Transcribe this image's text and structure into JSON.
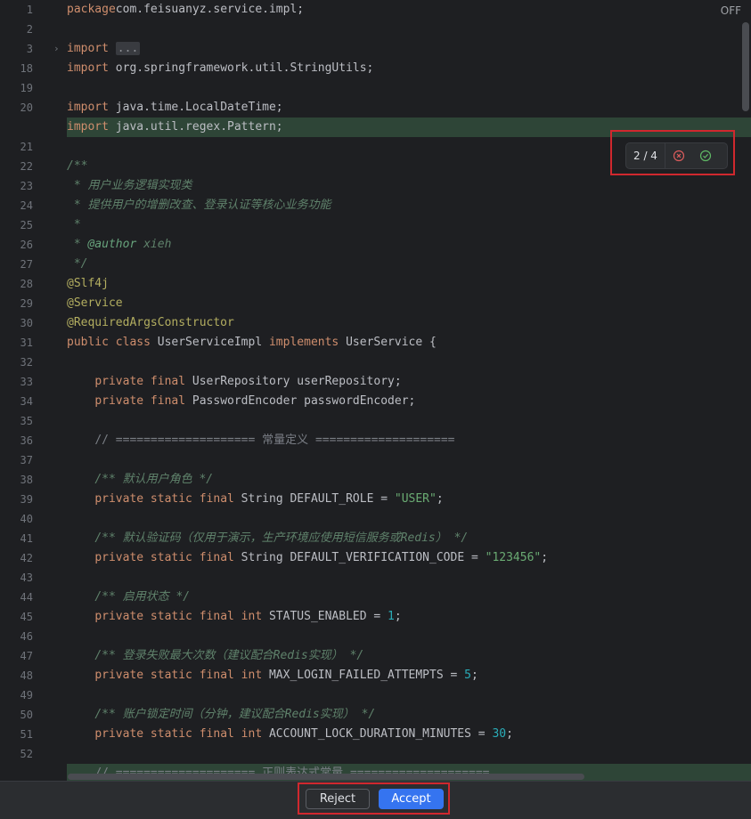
{
  "editor": {
    "off_label": "OFF",
    "diff_counter": "2 / 4",
    "lines": [
      {
        "num": "1",
        "segs": [
          [
            "kw",
            "package"
          ],
          [
            "",
            "com.feisuanyz.service.impl;"
          ]
        ]
      },
      {
        "num": "2",
        "segs": []
      },
      {
        "num": "3",
        "fold": "›",
        "segs": [
          [
            "kw",
            "import"
          ],
          [
            "",
            " "
          ],
          [
            "fold-box",
            "..."
          ]
        ]
      },
      {
        "num": "18",
        "segs": [
          [
            "kw",
            "import"
          ],
          [
            "",
            " org.springframework.util.StringUtils;"
          ]
        ]
      },
      {
        "num": "19",
        "segs": []
      },
      {
        "num": "20",
        "segs": [
          [
            "kw",
            "import"
          ],
          [
            "",
            " java.time.LocalDateTime;"
          ]
        ]
      },
      {
        "num": "",
        "hl": true,
        "segs": [
          [
            "kw",
            "import"
          ],
          [
            "",
            " java.util.regex.Pattern;"
          ]
        ]
      },
      {
        "num": "21",
        "segs": []
      },
      {
        "num": "22",
        "segs": [
          [
            "dc",
            "/**"
          ]
        ]
      },
      {
        "num": "23",
        "segs": [
          [
            "dc",
            " * 用户业务逻辑实现类"
          ]
        ]
      },
      {
        "num": "24",
        "segs": [
          [
            "dc",
            " * 提供用户的增删改查、登录认证等核心业务功能"
          ]
        ]
      },
      {
        "num": "25",
        "segs": [
          [
            "dc",
            " *"
          ]
        ]
      },
      {
        "num": "26",
        "segs": [
          [
            "dc",
            " * "
          ],
          [
            "dt",
            "@author"
          ],
          [
            "dc",
            " xieh"
          ]
        ]
      },
      {
        "num": "27",
        "segs": [
          [
            "dc",
            " */"
          ]
        ]
      },
      {
        "num": "28",
        "segs": [
          [
            "an",
            "@Slf4j"
          ]
        ]
      },
      {
        "num": "29",
        "segs": [
          [
            "an",
            "@Service"
          ]
        ]
      },
      {
        "num": "30",
        "segs": [
          [
            "an",
            "@RequiredArgsConstructor"
          ]
        ]
      },
      {
        "num": "31",
        "segs": [
          [
            "kw",
            "public class"
          ],
          [
            "",
            " UserServiceImpl "
          ],
          [
            "kw",
            "implements"
          ],
          [
            "",
            " UserService {"
          ]
        ]
      },
      {
        "num": "32",
        "segs": []
      },
      {
        "num": "33",
        "segs": [
          [
            "",
            "    "
          ],
          [
            "kw",
            "private final"
          ],
          [
            "",
            " UserRepository userRepository;"
          ]
        ]
      },
      {
        "num": "34",
        "segs": [
          [
            "",
            "    "
          ],
          [
            "kw",
            "private final"
          ],
          [
            "",
            " PasswordEncoder passwordEncoder;"
          ]
        ]
      },
      {
        "num": "35",
        "segs": []
      },
      {
        "num": "36",
        "segs": [
          [
            "",
            "    "
          ],
          [
            "cm",
            "// ==================== 常量定义 ===================="
          ]
        ]
      },
      {
        "num": "37",
        "segs": []
      },
      {
        "num": "38",
        "segs": [
          [
            "",
            "    "
          ],
          [
            "dc",
            "/** 默认用户角色 */"
          ]
        ]
      },
      {
        "num": "39",
        "segs": [
          [
            "",
            "    "
          ],
          [
            "kw",
            "private static final"
          ],
          [
            "",
            " String DEFAULT_ROLE = "
          ],
          [
            "str",
            "\"USER\""
          ],
          [
            "",
            ";"
          ]
        ]
      },
      {
        "num": "40",
        "segs": []
      },
      {
        "num": "41",
        "segs": [
          [
            "",
            "    "
          ],
          [
            "dc",
            "/** 默认验证码（仅用于演示，生产环境应使用短信服务或Redis） */"
          ]
        ]
      },
      {
        "num": "42",
        "segs": [
          [
            "",
            "    "
          ],
          [
            "kw",
            "private static final"
          ],
          [
            "",
            " String DEFAULT_VERIFICATION_CODE = "
          ],
          [
            "str",
            "\"123456\""
          ],
          [
            "",
            ";"
          ]
        ]
      },
      {
        "num": "43",
        "segs": []
      },
      {
        "num": "44",
        "segs": [
          [
            "",
            "    "
          ],
          [
            "dc",
            "/** 启用状态 */"
          ]
        ]
      },
      {
        "num": "45",
        "segs": [
          [
            "",
            "    "
          ],
          [
            "kw",
            "private static final int"
          ],
          [
            "",
            " STATUS_ENABLED = "
          ],
          [
            "num",
            "1"
          ],
          [
            "",
            ";"
          ]
        ]
      },
      {
        "num": "46",
        "segs": []
      },
      {
        "num": "47",
        "segs": [
          [
            "",
            "    "
          ],
          [
            "dc",
            "/** 登录失败最大次数（建议配合Redis实现） */"
          ]
        ]
      },
      {
        "num": "48",
        "segs": [
          [
            "",
            "    "
          ],
          [
            "kw",
            "private static final int"
          ],
          [
            "",
            " MAX_LOGIN_FAILED_ATTEMPTS = "
          ],
          [
            "num",
            "5"
          ],
          [
            "",
            ";"
          ]
        ]
      },
      {
        "num": "49",
        "segs": []
      },
      {
        "num": "50",
        "segs": [
          [
            "",
            "    "
          ],
          [
            "dc",
            "/** 账户锁定时间（分钟，建议配合Redis实现） */"
          ]
        ]
      },
      {
        "num": "51",
        "segs": [
          [
            "",
            "    "
          ],
          [
            "kw",
            "private static final int"
          ],
          [
            "",
            " ACCOUNT_LOCK_DURATION_MINUTES = "
          ],
          [
            "num",
            "30"
          ],
          [
            "",
            ";"
          ]
        ]
      },
      {
        "num": "52",
        "segs": []
      },
      {
        "num": "",
        "hl": true,
        "segs": [
          [
            "",
            "    "
          ],
          [
            "cm",
            "// ==================== 正则表达式常量 ===================="
          ]
        ]
      }
    ]
  },
  "actions": {
    "reject_label": "Reject",
    "accept_label": "Accept"
  },
  "colors": {
    "accent": "#3574f0",
    "added_line_bg": "#2e4537",
    "highlight_box": "#d0282e"
  },
  "icons": {
    "reject_change": "circle-x-icon",
    "accept_change": "circle-check-icon"
  }
}
